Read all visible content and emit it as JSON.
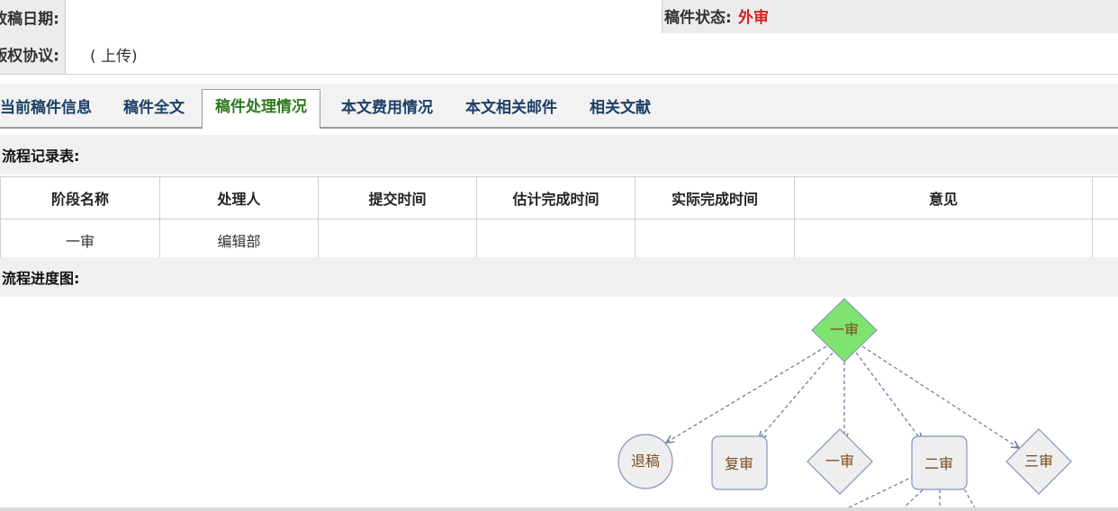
{
  "header": {
    "submit_date_label": "改稿日期:",
    "status_label": "稿件状态:",
    "status_value": "外审",
    "copyright_label": "版权协议:",
    "upload_link": "( 上传)"
  },
  "tabs": [
    {
      "label": "当前稿件信息"
    },
    {
      "label": "稿件全文"
    },
    {
      "label": "稿件处理情况"
    },
    {
      "label": "本文费用情况"
    },
    {
      "label": "本文相关邮件"
    },
    {
      "label": "相关文献"
    }
  ],
  "flow_record": {
    "title": "流程记录表:",
    "columns": [
      "阶段名称",
      "处理人",
      "提交时间",
      "估计完成时间",
      "实际完成时间",
      "意见"
    ],
    "rows": [
      [
        "一审",
        "编辑部",
        "",
        "",
        "",
        ""
      ]
    ]
  },
  "flow_chart": {
    "title": "流程进度图:",
    "nodes": {
      "root": "一审",
      "reject": "退稿",
      "re_review": "复审",
      "first": "一审",
      "second": "二审",
      "third": "三审"
    },
    "colors": {
      "active_fill": "#7ee36f",
      "node_fill": "#eeeeee",
      "node_stroke": "#7f94ba",
      "edge": "#6f7fa3",
      "status_red": "#d62020"
    }
  }
}
